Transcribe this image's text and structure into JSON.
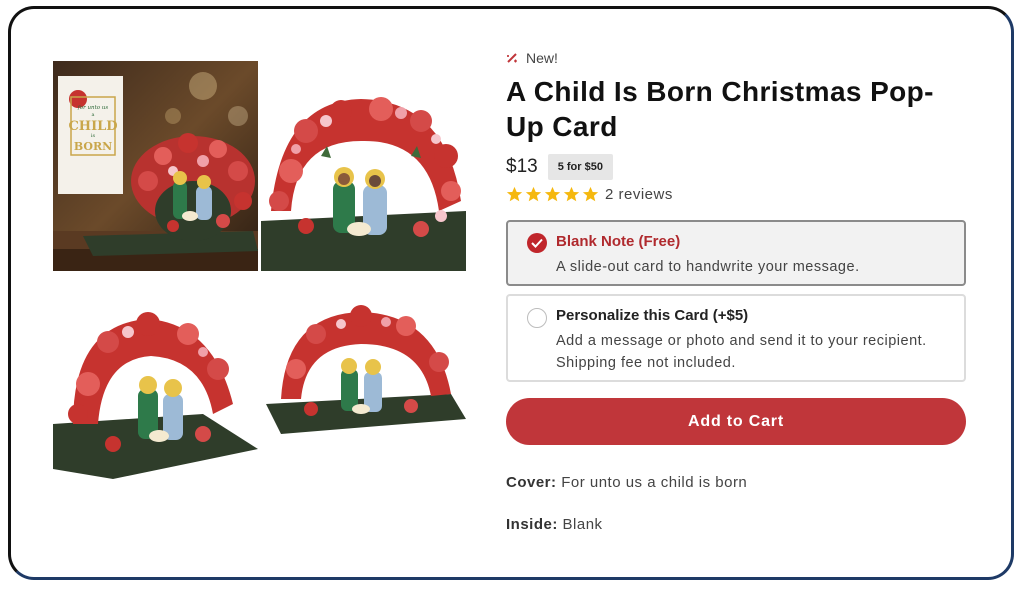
{
  "product": {
    "new_label": "New!",
    "title": "A Child Is Born Christmas Pop-Up Card",
    "price": "$13",
    "deal_badge": "5 for $50",
    "rating": 5,
    "reviews_text": "2 reviews",
    "cover_label": "Cover:",
    "cover_value": "For unto us a child is born",
    "inside_label": "Inside:",
    "inside_value": "Blank"
  },
  "card_text": {
    "line1": "for unto us",
    "line2": "a",
    "line3": "CHILD",
    "line4": "is",
    "line5": "BORN"
  },
  "options": [
    {
      "title": "Blank Note (Free)",
      "description": "A slide-out card to handwrite your message.",
      "selected": true
    },
    {
      "title": "Personalize this Card (+$5)",
      "description": "Add a message or photo and send it to your recipient. Shipping fee not included.",
      "selected": false
    }
  ],
  "add_to_cart_label": "Add to Cart",
  "colors": {
    "accent": "#c0363a",
    "selected_text": "#b02a2e",
    "star": "#f5b80f"
  },
  "icons": {
    "new": "sparkle-icon",
    "star": "star-icon",
    "check": "check-icon"
  }
}
